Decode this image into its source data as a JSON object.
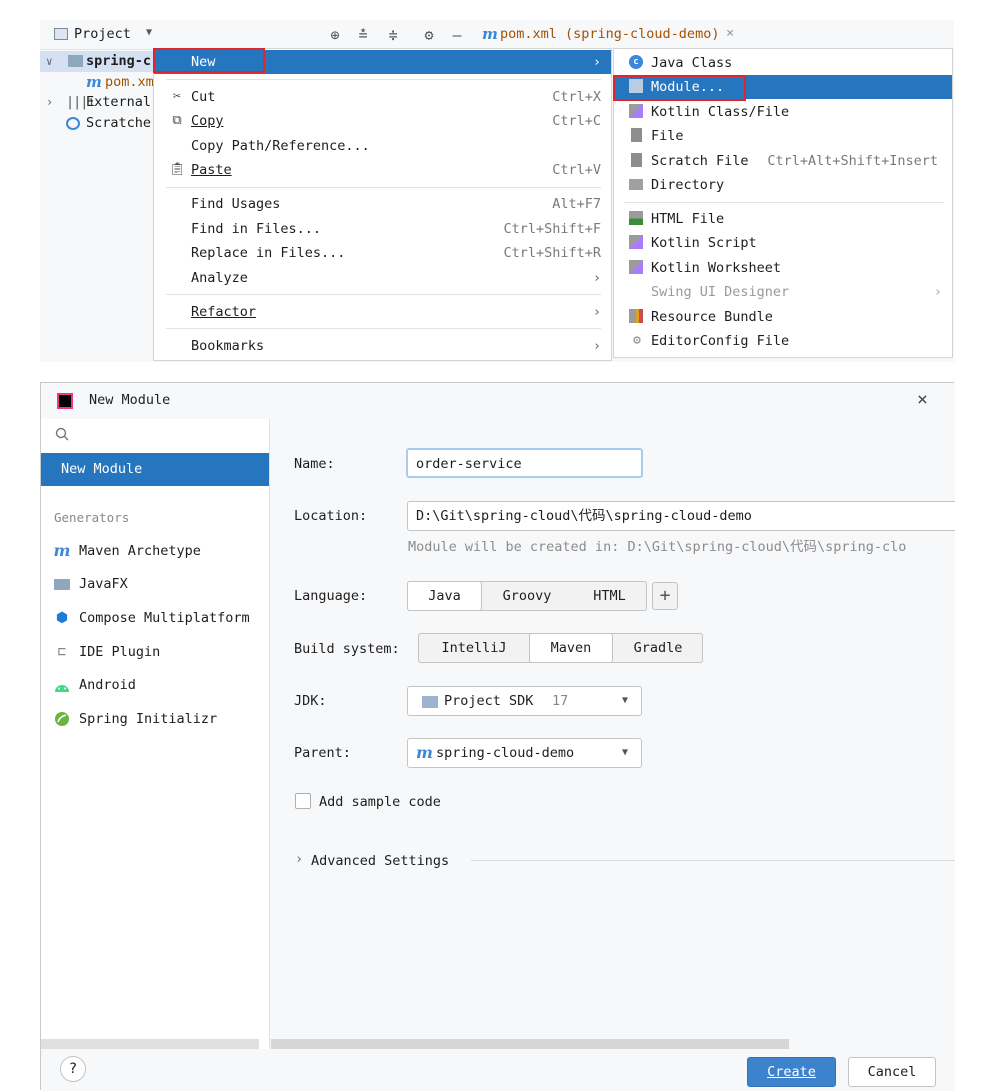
{
  "project_panel": {
    "title": "Project",
    "tree": {
      "root": "spring-c",
      "pom": "pom.xm",
      "external": "External",
      "scratches": "Scratche"
    }
  },
  "editor_tab": {
    "file": "pom.xml (spring-cloud-demo)",
    "close": "×"
  },
  "context_menu": {
    "new": "New",
    "cut": {
      "label": "Cut",
      "u": "u",
      "shortcut": "Ctrl+X"
    },
    "copy": {
      "label": "Copy",
      "shortcut": "Ctrl+C"
    },
    "copy_path": "Copy Path/Reference...",
    "paste": {
      "label": "Paste",
      "shortcut": "Ctrl+V"
    },
    "find_usages": {
      "label": "Find Usages",
      "shortcut": "Alt+F7"
    },
    "find_in_files": {
      "label": "Find in Files...",
      "shortcut": "Ctrl+Shift+F"
    },
    "replace_in_files": {
      "label": "Replace in Files...",
      "shortcut": "Ctrl+Shift+R"
    },
    "analyze": "Analyze",
    "refactor": "Refactor",
    "bookmarks": "Bookmarks"
  },
  "new_submenu": {
    "java_class": "Java Class",
    "module": "Module...",
    "kotlin_class": "Kotlin Class/File",
    "file": "File",
    "scratch_file": {
      "label": "Scratch File",
      "shortcut": "Ctrl+Alt+Shift+Insert"
    },
    "directory": "Directory",
    "html_file": "HTML File",
    "kotlin_script": "Kotlin Script",
    "kotlin_worksheet": "Kotlin Worksheet",
    "swing_ui": "Swing UI Designer",
    "resource_bundle": "Resource Bundle",
    "editorconfig": "EditorConfig File"
  },
  "dialog": {
    "title": "New Module",
    "close": "×",
    "selected_item": "New Module",
    "generators_header": "Generators",
    "generators": [
      {
        "label": "Maven Archetype",
        "icon": "maven-icon"
      },
      {
        "label": "JavaFX",
        "icon": "folder-icon"
      },
      {
        "label": "Compose Multiplatform",
        "icon": "compose-icon"
      },
      {
        "label": "IDE Plugin",
        "icon": "plugin-icon"
      },
      {
        "label": "Android",
        "icon": "android-icon"
      },
      {
        "label": "Spring Initializr",
        "icon": "spring-icon"
      }
    ],
    "form": {
      "name_label": "Name:",
      "name_value": "order-service",
      "location_label": "Location:",
      "location_value": "D:\\Git\\spring-cloud\\代码\\spring-cloud-demo",
      "location_hint": "Module will be created in: D:\\Git\\spring-cloud\\代码\\spring-clo",
      "language_label": "Language:",
      "languages": [
        "Java",
        "Groovy",
        "HTML"
      ],
      "language_add": "+",
      "build_label": "Build system:",
      "builds": [
        "IntelliJ",
        "Maven",
        "Gradle"
      ],
      "jdk_label": "JDK:",
      "jdk_value": "Project SDK",
      "jdk_version": "17",
      "parent_label": "Parent:",
      "parent_value": "spring-cloud-demo",
      "sample_code": "Add sample code",
      "advanced": "Advanced Settings"
    },
    "help": "?",
    "create": "Create",
    "cancel": "Cancel"
  },
  "colors": {
    "accent": "#2675bf",
    "highlight_box": "#e0262a",
    "create_btn": "#3d82cc"
  }
}
